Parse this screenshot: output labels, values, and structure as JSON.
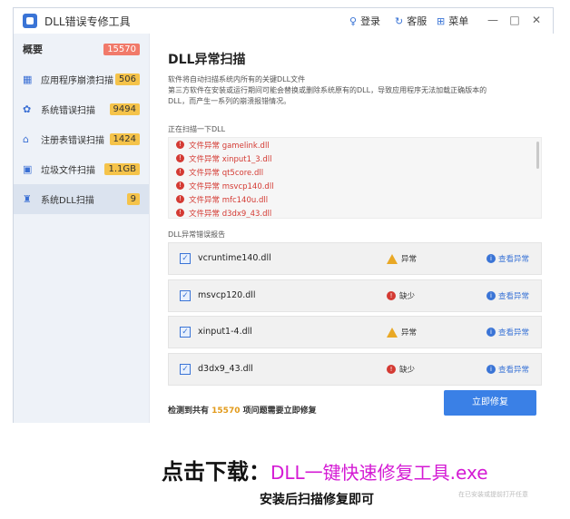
{
  "app": {
    "title": "DLL错误专修工具"
  },
  "titlebar": {
    "login": "登录",
    "service": "客服",
    "menu": "菜单"
  },
  "sidebar": {
    "overview": {
      "label": "概要",
      "count": "15570"
    },
    "items": [
      {
        "icon": "grid-icon",
        "label": "应用程序崩溃扫描",
        "count": "506"
      },
      {
        "icon": "gear-icon",
        "label": "系统错误扫描",
        "count": "9494"
      },
      {
        "icon": "registry-icon",
        "label": "注册表错误扫描",
        "count": "1424"
      },
      {
        "icon": "trash-box-icon",
        "label": "垃圾文件扫描",
        "count": "1.1GB"
      },
      {
        "icon": "trash-icon",
        "label": "系统DLL扫描",
        "count": "9"
      }
    ]
  },
  "main": {
    "title": "DLL异常扫描",
    "desc": [
      "软件将自动扫描系统内所有的关键DLL文件",
      "第三方软件在安装或运行期间可能会替换或删除系统原有的DLL，导致应用程序无法加载正确版本的",
      "DLL，而产生一系列的崩溃报错情况。"
    ],
    "scanning_label": "正在扫描一下DLL",
    "scan_lines": [
      "文件异常 gamelink.dll",
      "文件异常 xinput1_3.dll",
      "文件异常 qt5core.dll",
      "文件异常 msvcp140.dll",
      "文件异常 mfc140u.dll",
      "文件异常 d3dx9_43.dll"
    ],
    "report_label": "DLL异常错误报告",
    "report_rows": [
      {
        "name": "vcruntime140.dll",
        "status": "异常",
        "status_type": "warn",
        "action": "查看异常"
      },
      {
        "name": "msvcp120.dll",
        "status": "缺少",
        "status_type": "error",
        "action": "查看异常"
      },
      {
        "name": "xinput1-4.dll",
        "status": "异常",
        "status_type": "warn",
        "action": "查看异常"
      },
      {
        "name": "d3dx9_43.dll",
        "status": "缺少",
        "status_type": "error",
        "action": "查看异常"
      }
    ],
    "footer": {
      "prefix": "检测到共有",
      "count": "15570",
      "suffix": "项问题需要立即修复"
    },
    "fix_button": "立即修复"
  },
  "promo": {
    "line1_prefix": "点击下载：",
    "line1_link": "DLL一键快速修复工具.exe",
    "line2": "安装后扫描修复即可",
    "watermark": "在已安装或提前打开任意"
  },
  "colors": {
    "accent": "#3a80e6",
    "error": "#d43a33",
    "warn": "#e9a825",
    "link": "#d41ad4"
  }
}
